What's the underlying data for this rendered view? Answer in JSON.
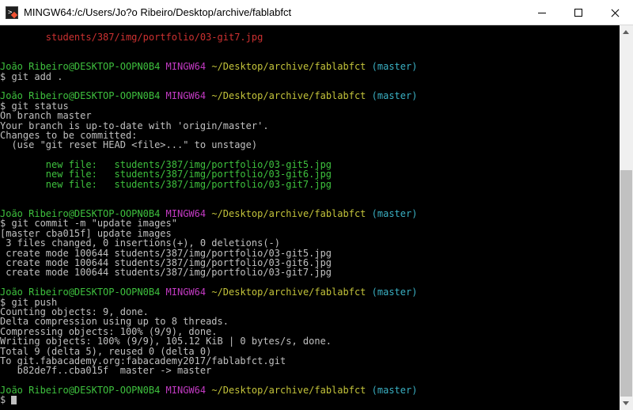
{
  "window": {
    "title": "MINGW64:/c/Users/Jo?o Ribeiro/Desktop/archive/fablabfct",
    "icon": "git-bash-icon",
    "controls": {
      "minimize": "minimize-icon",
      "maximize": "maximize-icon",
      "close": "close-icon"
    }
  },
  "colors": {
    "background": "#000000",
    "text": "#c0c0c0",
    "user_host": "#3ec13e",
    "shell_name": "#c33ac3",
    "path": "#c3c33a",
    "branch": "#3ab0c3",
    "deleted_file": "#cd3131",
    "staged_file": "#3ec13e"
  },
  "prompt": {
    "user_host": "João Ribeiro@DESKTOP-OOPN0B4",
    "shell": "MINGW64",
    "path": "~/Desktop/archive/fablabfct",
    "branch": "(master)",
    "symbol": "$"
  },
  "terminal": {
    "top_partial": "        students/387/img/portfolio/03-git7.jpg",
    "cmd_add": "$ git add .",
    "cmd_status": "$ git status",
    "status_lines": [
      "On branch master",
      "Your branch is up-to-date with 'origin/master'.",
      "Changes to be committed:",
      "  (use \"git reset HEAD <file>...\" to unstage)"
    ],
    "staged_files": [
      "        new file:   students/387/img/portfolio/03-git5.jpg",
      "        new file:   students/387/img/portfolio/03-git6.jpg",
      "        new file:   students/387/img/portfolio/03-git7.jpg"
    ],
    "cmd_commit": "$ git commit -m \"update images\"",
    "commit_lines": [
      "[master cba015f] update images",
      " 3 files changed, 0 insertions(+), 0 deletions(-)",
      " create mode 100644 students/387/img/portfolio/03-git5.jpg",
      " create mode 100644 students/387/img/portfolio/03-git6.jpg",
      " create mode 100644 students/387/img/portfolio/03-git7.jpg"
    ],
    "cmd_push": "$ git push",
    "push_lines": [
      "Counting objects: 9, done.",
      "Delta compression using up to 8 threads.",
      "Compressing objects: 100% (9/9), done.",
      "Writing objects: 100% (9/9), 105.12 KiB | 0 bytes/s, done.",
      "Total 9 (delta 5), reused 0 (delta 0)",
      "To git.fabacademy.org:fabacademy2017/fablabfct.git",
      "   b82de7f..cba015f  master -> master"
    ],
    "final_prompt_symbol": "$"
  }
}
